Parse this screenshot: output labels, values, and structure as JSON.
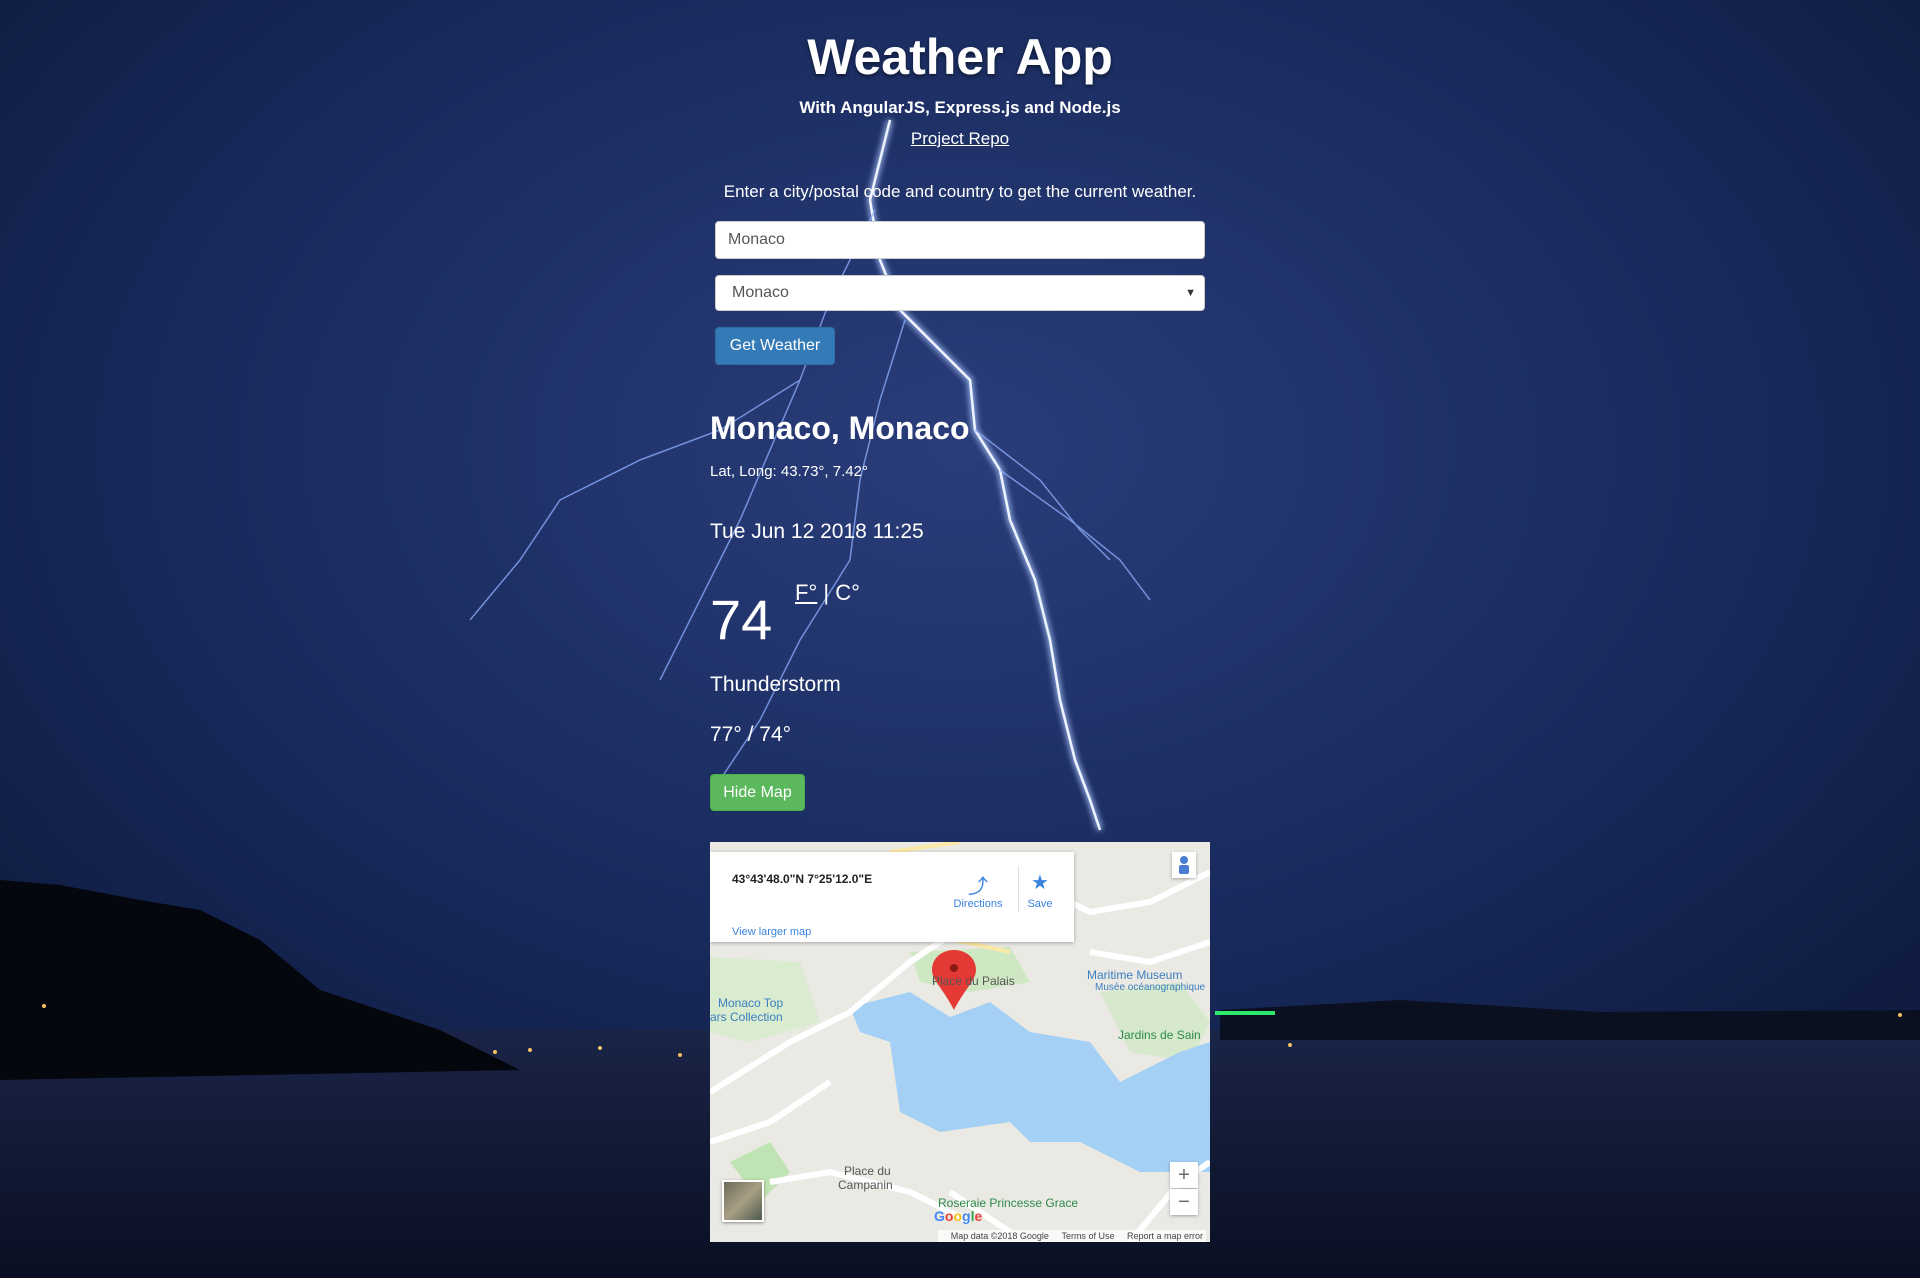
{
  "header": {
    "title": "Weather App",
    "subtitle": "With AngularJS, Express.js and Node.js",
    "repo_link": "Project Repo"
  },
  "form": {
    "instructions": "Enter a city/postal code and country to get the current weather.",
    "city_value": "Monaco",
    "country_selected": "Monaco",
    "submit_label": "Get Weather"
  },
  "weather": {
    "location": "Monaco, Monaco",
    "latlong": "Lat, Long: 43.73°, 7.42°",
    "datetime": "Tue Jun 12 2018 11:25",
    "temperature": "74",
    "unit_f": "F°",
    "unit_sep": " | ",
    "unit_c": "C°",
    "condition": "Thunderstorm",
    "hilo": "77° / 74°",
    "hide_map_label": "Hide Map"
  },
  "map": {
    "coords": "43°43'48.0\"N 7°25'12.0\"E",
    "directions": "Directions",
    "save": "Save",
    "view_larger": "View larger map",
    "labels": {
      "place_du_palais": "Place du Palais",
      "maritime_museum": "Maritime Museum",
      "musee": "Musée océanographique",
      "jardins": "Jardins de Sain",
      "monaco_top": "Monaco Top",
      "cars_collection": "ars Collection",
      "place_du_campanin_1": "Place du",
      "place_du_campanin_2": "Campanin",
      "roseraie": "Roseraie Princesse Grace"
    },
    "zoom_in": "+",
    "zoom_out": "−",
    "google": "Google",
    "footer": {
      "data": "Map data ©2018 Google",
      "terms": "Terms of Use",
      "report": "Report a map error"
    }
  },
  "colors": {
    "primary_button": "#337ab7",
    "success_button": "#5cb85c",
    "water": "#a5d0f5",
    "pin": "#e53935"
  }
}
